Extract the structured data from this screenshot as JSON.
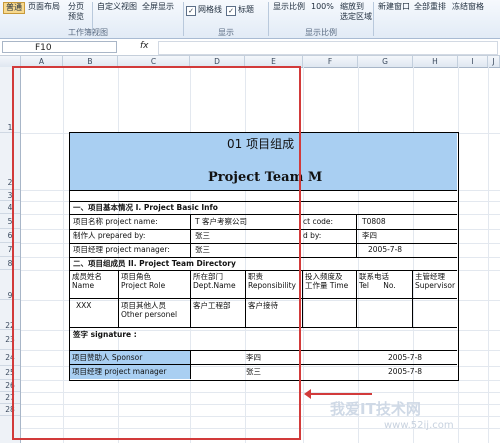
{
  "ribbon": {
    "items": {
      "normal": "普通",
      "page_layout": "页面布局",
      "page_break": "分页\n预览",
      "custom_view": "自定义视图",
      "full_screen": "全屏显示",
      "gridlines": "网格线",
      "headings": "标题",
      "zoom": "显示比例",
      "zoom100": "100%",
      "zoom_selection": "缩放到\n选定区域",
      "new_window": "新建窗口",
      "arrange_all": "全部重排",
      "freeze": "冻结窗格"
    },
    "groups": {
      "workbook_views": "工作簿视图",
      "show": "显示",
      "zoom": "显示比例"
    }
  },
  "formula_bar": {
    "cell_ref": "F10",
    "fx": "fx",
    "value": ""
  },
  "columns": [
    "A",
    "B",
    "C",
    "D",
    "E",
    "F",
    "G",
    "H",
    "I",
    "J"
  ],
  "rows": [
    "1",
    "2",
    "3",
    "4",
    "5",
    "6",
    "7",
    "8",
    "9",
    "22",
    "23",
    "24",
    "25",
    "26",
    "27",
    "28"
  ],
  "document": {
    "title_cn": "01 项目组成",
    "title_en": "Project Team M",
    "section1": "一、项目基本情况  I. Project Basic Info",
    "project_name_label": "项目名称 project name:",
    "project_name_value": "T 客户考察公司",
    "project_code_label": "ct code:",
    "project_code_value": "T0808",
    "prepared_label": "制作人 prepared by:",
    "prepared_value": "张三",
    "approved_label": "d by:",
    "approved_value": "李四",
    "pm_label": "项目经理 project manager:",
    "pm_value": "张三",
    "date1": "2005-7-8",
    "section2": "二、项目组成员  II. Project Team Directory",
    "headers": [
      "成员姓名\nName",
      "项目角色\nProject Role",
      "所在部门\nDept.Name",
      "职责\nReponsibility",
      "投入频度及\n工作量 Time",
      "联系电话\nTel      No.",
      "主管经理\nSupervisor"
    ],
    "row": [
      "XXX",
      "项目其他人员\nOther personel",
      "客户工程部",
      "客户接待"
    ],
    "signature": "签字  signature :",
    "sponsor_label": "项目赞助人 Sponsor",
    "sponsor_value": "李四",
    "sponsor_date": "2005-7-8",
    "manager_label": "项目经理 project manager",
    "manager_value": "张三",
    "manager_date": "2005-7-8"
  },
  "watermark": {
    "text": "我爱IT技术网",
    "url": "www.52ij.com"
  },
  "colors": {
    "accent_blue": "#a9cff2",
    "annotation_red": "#d23a3a"
  }
}
